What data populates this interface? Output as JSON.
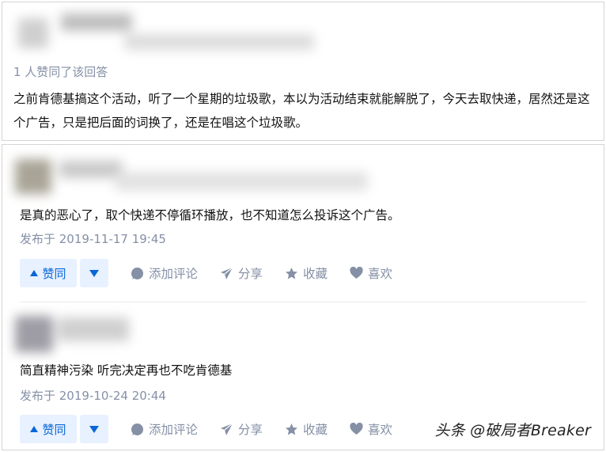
{
  "top_answer": {
    "endorse_text": "1 人赞同了该回答",
    "content": "之前肯德基搞这个活动，听了一个星期的垃圾歌，本以为活动结束就能解脱了，今天去取快递，居然还是这个广告，只是把后面的词换了，还是在唱这个垃圾歌。"
  },
  "comments": [
    {
      "content": "是真的恶心了，取个快递不停循环播放，也不知道怎么投诉这个广告。",
      "date": "发布于 2019-11-17 19:45"
    },
    {
      "content": "简直精神污染 听完决定再也不吃肯德基",
      "date": "发布于 2019-10-24 20:44"
    }
  ],
  "actions": {
    "vote_up": "赞同",
    "comment": "添加评论",
    "share": "分享",
    "collect": "收藏",
    "like": "喜欢"
  },
  "watermark": "头条 @破局者Breaker",
  "colors": {
    "accent_blue": "#0a66d8",
    "vote_bg": "#e7f1ff",
    "meta_gray": "#8590a6"
  }
}
